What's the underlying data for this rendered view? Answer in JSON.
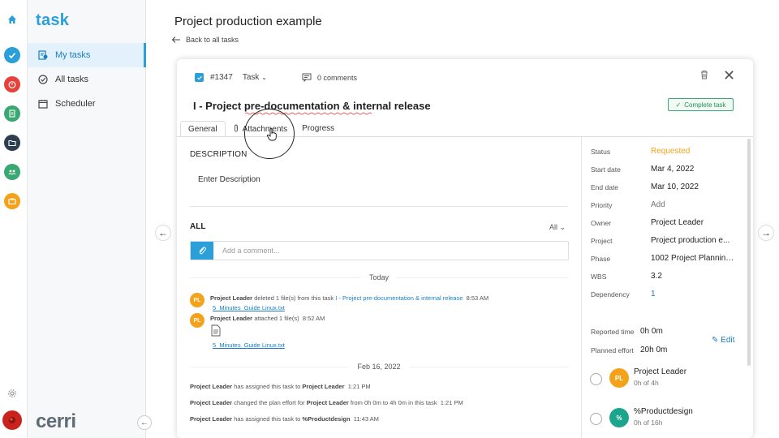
{
  "app": {
    "logo": "task",
    "brand": "cerri"
  },
  "rail": {
    "icons": [
      {
        "name": "home-icon",
        "color": "#2a9fd8"
      },
      {
        "name": "check-circle-icon",
        "color": "#2a9fd8"
      },
      {
        "name": "stopwatch-icon",
        "color": "#e8413c"
      },
      {
        "name": "document-icon",
        "color": "#3aa872"
      },
      {
        "name": "folder-icon",
        "color": "#2d3e4e"
      },
      {
        "name": "team-icon",
        "color": "#3aa872"
      },
      {
        "name": "briefcase-icon",
        "color": "#f5a21b"
      }
    ]
  },
  "sidebar": {
    "items": [
      {
        "label": "My tasks",
        "active": true
      },
      {
        "label": "All tasks",
        "active": false
      },
      {
        "label": "Scheduler",
        "active": false
      }
    ]
  },
  "header": {
    "title": "Project production example",
    "back_label": "Back to all tasks"
  },
  "task": {
    "id": "#1347",
    "type": "Task",
    "comments": "0 comments",
    "title": "I - Project pre-documentation & internal release",
    "complete_label": "Complete task",
    "tabs": [
      "General",
      "Attachments",
      "Progress"
    ]
  },
  "general": {
    "description_label": "DESCRIPTION",
    "description_placeholder": "Enter Description",
    "activity_label": "ALL",
    "filter_label": "All",
    "comment_placeholder": "Add a comment..."
  },
  "activity": {
    "today_label": "Today",
    "entries_today": [
      {
        "avatar": "PL",
        "user": "Project Leader",
        "text": " deleted 1 file(s) from this task ",
        "task_link": "I - Project pre-documentation & internal release",
        "time": "8:53 AM",
        "file": "5_Minutes_Guide Linux.txt"
      },
      {
        "avatar": "PL",
        "user": "Project Leader",
        "text": " attached 1 file(s)",
        "time": "8:52 AM",
        "file": "5_Minutes_Guide Linux.txt"
      }
    ],
    "feb_label": "Feb 16, 2022",
    "entries_feb": [
      {
        "user": "Project Leader",
        "pre": " has assigned this task to ",
        "target": "Project Leader",
        "post": "",
        "time": "1:21 PM"
      },
      {
        "user": "Project Leader",
        "pre": " changed the plan effort for ",
        "target": "Project Leader",
        "post": " from 0h 0m to 4h 0m in this task",
        "time": "1:21 PM"
      },
      {
        "user": "Project Leader",
        "pre": " has assigned this task to ",
        "target": "%Productdesign",
        "post": "",
        "time": "11:43 AM"
      }
    ]
  },
  "properties": {
    "status": {
      "label": "Status",
      "value": "Requested",
      "color": "#f5a21b"
    },
    "start": {
      "label": "Start date",
      "value": "Mar 4, 2022"
    },
    "end": {
      "label": "End date",
      "value": "Mar 10, 2022"
    },
    "priority": {
      "label": "Priority",
      "value": "Add"
    },
    "owner": {
      "label": "Owner",
      "value": "Project Leader"
    },
    "project": {
      "label": "Project",
      "value": "Project production e..."
    },
    "phase": {
      "label": "Phase",
      "value": "1002 Project Planning..."
    },
    "wbs": {
      "label": "WBS",
      "value": "3.2"
    },
    "dependency": {
      "label": "Dependency",
      "value": "1"
    },
    "reported": {
      "label": "Reported time",
      "value": "0h 0m"
    },
    "planned": {
      "label": "Planned effort",
      "value": "20h 0m"
    },
    "edit_label": "Edit"
  },
  "assignees": [
    {
      "initials": "PL",
      "name": "Project Leader",
      "effort": "0h  of 4h",
      "color": "#f5a21b"
    },
    {
      "initials": "%",
      "name": "%Productdesign",
      "effort": "0h  of 16h",
      "color": "#1aa58c"
    }
  ]
}
